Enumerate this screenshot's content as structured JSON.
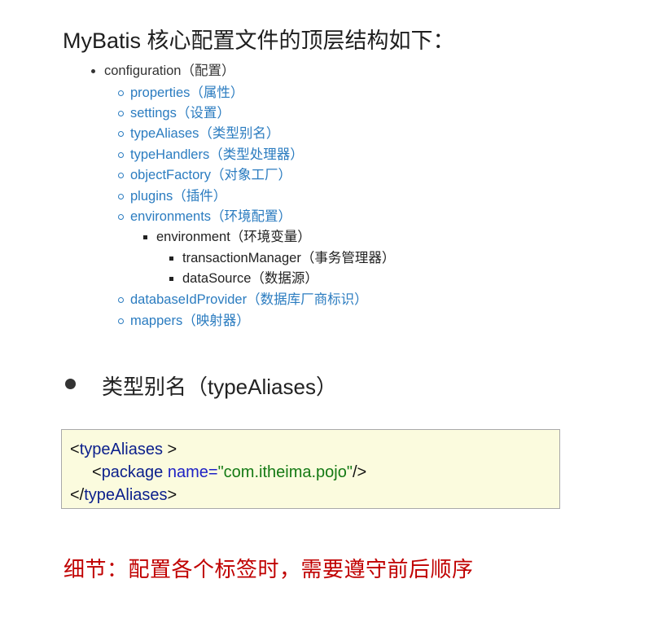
{
  "heading": "MyBatis 核心配置文件的顶层结构如下：",
  "tree": {
    "root": "configuration（配置）",
    "properties": "properties（属性）",
    "settings": "settings（设置）",
    "typeAliases": "typeAliases（类型别名）",
    "typeHandlers": "typeHandlers（类型处理器）",
    "objectFactory": "objectFactory（对象工厂）",
    "plugins": "plugins（插件）",
    "environments": "environments（环境配置）",
    "environment": "environment（环境变量）",
    "transactionManager": "transactionManager（事务管理器）",
    "dataSource": "dataSource（数据源）",
    "databaseIdProvider": "databaseIdProvider（数据库厂商标识）",
    "mappers": "mappers（映射器）"
  },
  "section": {
    "title": "类型别名（typeAliases）"
  },
  "code": {
    "line1_open": "<",
    "line1_tag": "typeAliases",
    "line1_close": " >",
    "line2_open": "<",
    "line2_tag": "package",
    "line2_attr": " name=",
    "line2_value": "\"com.itheima.pojo\"",
    "line2_close": "/>",
    "line3_open": "</",
    "line3_tag": "typeAliases",
    "line3_close": ">"
  },
  "note": "细节：配置各个标签时，需要遵守前后顺序",
  "colors": {
    "link_blue": "#2b7cc0",
    "note_red": "#c00000",
    "code_bg": "#fbfbde",
    "code_string": "#147a14"
  }
}
